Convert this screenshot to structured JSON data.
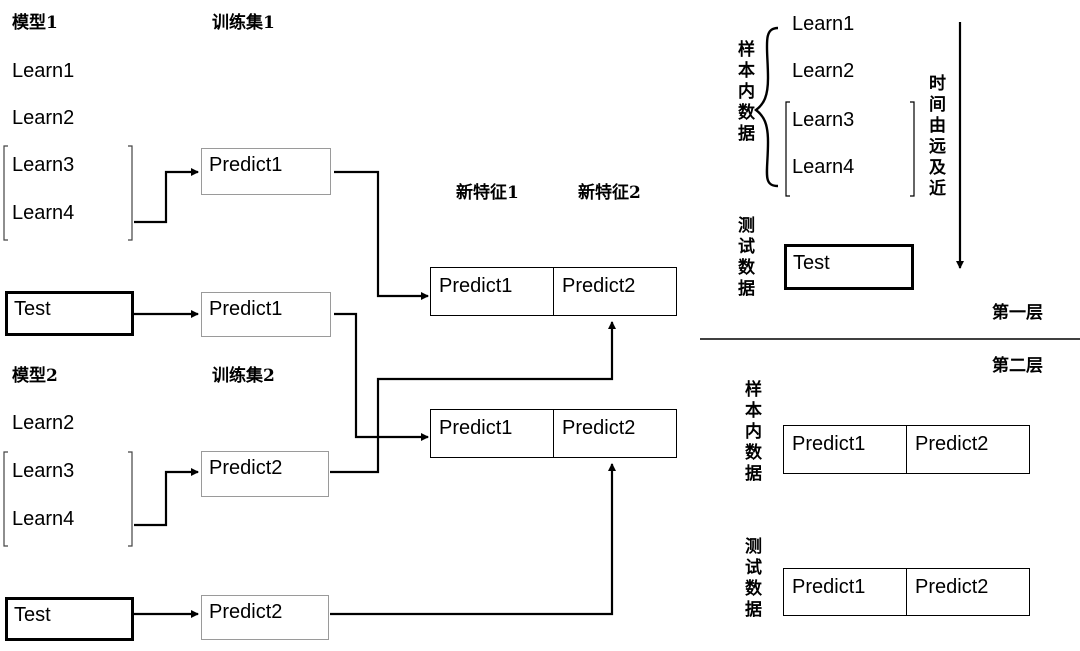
{
  "block1": {
    "model_title": "模型1",
    "train_title": "训练集1",
    "learn": [
      "Learn1",
      "Learn2",
      "Learn3",
      "Learn4"
    ],
    "predict_train": "Predict1",
    "test": "Test",
    "predict_test": "Predict1"
  },
  "block2": {
    "model_title": "模型2",
    "train_title": "训练集2",
    "learn": [
      "Learn2",
      "Learn3",
      "Learn4"
    ],
    "predict_train": "Predict2",
    "test": "Test",
    "predict_test": "Predict2"
  },
  "features": {
    "header1": "新特征1",
    "header2": "新特征2",
    "row1": [
      "Predict1",
      "Predict2"
    ],
    "row2": [
      "Predict1",
      "Predict2"
    ]
  },
  "layer1": {
    "in_sample_label": "样本内数据",
    "learn": [
      "Learn1",
      "Learn2",
      "Learn3",
      "Learn4"
    ],
    "time_label": "时间由远及近",
    "test_label": "测试数据",
    "test": "Test",
    "layer_name": "第一层"
  },
  "layer2": {
    "layer_name": "第二层",
    "in_sample_label": "样本内数据",
    "in_sample_row": [
      "Predict1",
      "Predict2"
    ],
    "test_label": "测试数据",
    "test_row": [
      "Predict1",
      "Predict2"
    ]
  }
}
